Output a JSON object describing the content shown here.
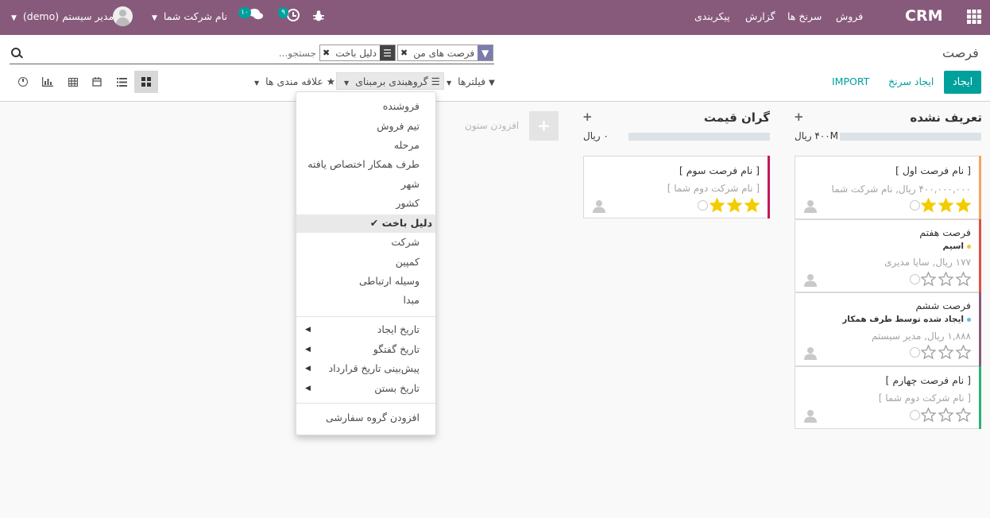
{
  "navbar": {
    "app_title": "CRM",
    "menu": [
      "فروش",
      "سرنخ ها",
      "گزارش",
      "پیکربندی"
    ],
    "company": "نام شرکت شما",
    "user": "مدیر سیستم (demo)",
    "chat_count": "۱۰",
    "activity_count": "۹",
    "colors": {
      "bar": "#875a7b",
      "chat_badge": "#00a09d"
    }
  },
  "breadcrumb": "فرصت",
  "search": {
    "placeholder": "جستجو...",
    "facets": [
      {
        "icon": "filter-icon",
        "value": "فرصت های من"
      },
      {
        "icon": "group-icon",
        "value": "دلیل باخت"
      }
    ]
  },
  "buttons": {
    "create": "ایجاد",
    "create_lead": "ایجاد سرنخ",
    "import": "IMPORT"
  },
  "search_options": {
    "filters": "فیلترها",
    "group_by": "گروهبندی برمبنای",
    "favorites": "علاقه مندی ها"
  },
  "groupby_menu": {
    "items": [
      "فروشنده",
      "تیم فروش",
      "مرحله",
      "طرف همکار اختصاص یافته",
      "شهر",
      "کشور",
      "دلیل باخت",
      "شرکت",
      "کمپین",
      "وسیله ارتباطی",
      "مبدا"
    ],
    "selected": "دلیل باخت",
    "date_items": [
      "تاریخ ایجاد",
      "تاریخ گفتگو",
      "پیش‌بینی تاریخ قرارداد",
      "تاریخ بستن"
    ],
    "custom": "افزودن گروه سفارشی"
  },
  "add_column": "افزودن ستون",
  "columns": [
    {
      "title": "تعریف نشده",
      "total": "۴۰۰M ریال",
      "cards": [
        {
          "title": "[ نام فرصت اول ]",
          "subtitle": "۴۰۰,۰۰۰,۰۰۰ ریال, نام شرکت شما",
          "tag": "",
          "stars": 3,
          "color": "#f4a460"
        },
        {
          "title": "فرصت هفتم",
          "subtitle": "۱۷۷ ریال, سایا مدیری",
          "tag": "اسیم",
          "tag_color": "#f3c43c",
          "stars": 0,
          "color": "#e04f3f"
        },
        {
          "title": "فرصت ششم",
          "subtitle": "۱,۸۸۸ ریال, مدیر سیستم",
          "tag": "ایجاد شده توسط طرف همکار",
          "tag_color": "#5bc0de",
          "stars": 0,
          "color": "#875a7b"
        },
        {
          "title": "[ نام فرصت چهارم ]",
          "subtitle": "[ نام شرکت دوم شما ]",
          "tag": "",
          "stars": 0,
          "color": "#29b36f"
        }
      ]
    },
    {
      "title": "گران قیمت",
      "total": "۰ ریال",
      "cards": [
        {
          "title": "[ نام فرصت سوم ]",
          "subtitle": "[ نام شرکت دوم شما ]",
          "tag": "",
          "stars": 3,
          "color": "#c2185b"
        }
      ]
    }
  ]
}
